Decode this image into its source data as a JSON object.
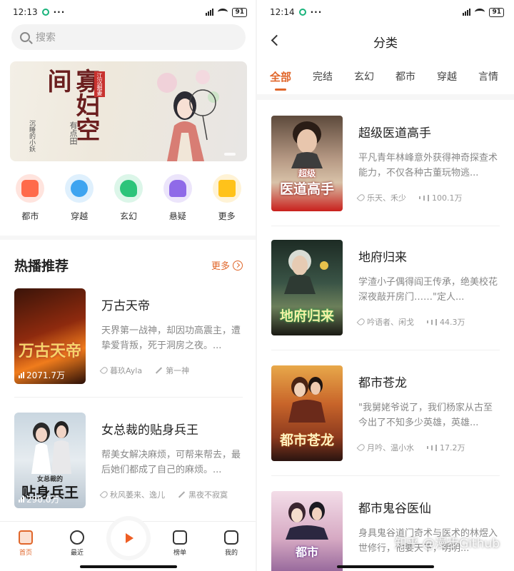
{
  "left": {
    "status": {
      "time": "12:13",
      "battery": "91"
    },
    "search": {
      "placeholder": "搜索"
    },
    "banner": {
      "title": "寡妇空间",
      "tag": "江汉掘妻",
      "sub": "有点田",
      "author": "沉睡的小妖"
    },
    "categories": [
      {
        "label": "都市",
        "color": "#ff6a4a",
        "bg": "#ffe4de"
      },
      {
        "label": "穿越",
        "color": "#3ea4f0",
        "bg": "#dff0fd"
      },
      {
        "label": "玄幻",
        "color": "#2cc47a",
        "bg": "#dcf6e9"
      },
      {
        "label": "悬疑",
        "color": "#8f6ae8",
        "bg": "#ece5fb"
      },
      {
        "label": "更多",
        "color": "#ffc21a",
        "bg": "#fff3d6"
      }
    ],
    "hot": {
      "title": "热播推荐",
      "more": "更多",
      "items": [
        {
          "title": "万古天帝",
          "desc": "天界第一战神，却因功高震主，遭挚爱背叛，死于洞房之夜。...",
          "count": "2071.7万",
          "narrator": "暮玖Ayla",
          "author": "第一神",
          "cover_text": "万古天帝"
        },
        {
          "title": "女总裁的贴身兵王",
          "desc": "帮美女解决麻烦，可帮来帮去，最后她们都成了自己的麻烦。...",
          "count": "290.0万",
          "narrator": "秋风萎来、逸儿",
          "author": "黑夜不寂寞",
          "cover_text": "贴身兵王",
          "cover_small": "女总裁的"
        }
      ]
    },
    "tabbar": [
      {
        "label": "首页"
      },
      {
        "label": "最近"
      },
      {
        "label": ""
      },
      {
        "label": "榜单"
      },
      {
        "label": "我的"
      }
    ]
  },
  "right": {
    "status": {
      "time": "12:14",
      "battery": "91"
    },
    "nav": {
      "title": "分类"
    },
    "tabs": [
      "全部",
      "完结",
      "玄幻",
      "都市",
      "穿越",
      "言情"
    ],
    "books": [
      {
        "title": "超级医道高手",
        "desc": "平凡青年林峰意外获得神奇探查术能力，不仅各种古董玩物逃...",
        "narrator": "乐天、禾少",
        "count": "100.1万",
        "cover_text": "医道高手",
        "cover_small": "超级"
      },
      {
        "title": "地府归来",
        "desc": "学渣小子偶得阎王传承，绝美校花深夜敲开房门……\"定人...",
        "narrator": "吟语者、闲戈",
        "count": "44.3万",
        "cover_text": "地府归来"
      },
      {
        "title": "都市苍龙",
        "desc": "\"我舅姥爷说了，我们杨家从古至今出了不知多少英雄，英雄...",
        "narrator": "月吟、温小水",
        "count": "17.2万",
        "cover_text": "都市苍龙"
      },
      {
        "title": "都市鬼谷医仙",
        "desc": "身具鬼谷道门奇术与医术的林煜入世修行，他要天下，明明...",
        "narrator": "",
        "count": "",
        "cover_text": "都市"
      }
    ],
    "watermark": "知乎 @漫步Github"
  }
}
